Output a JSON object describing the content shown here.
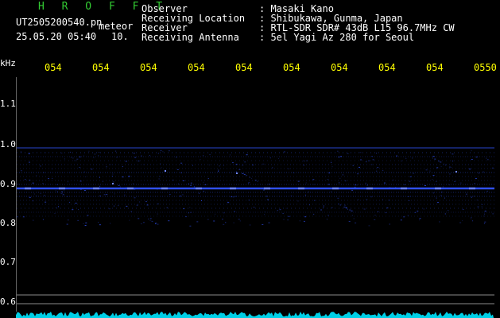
{
  "header": {
    "app_title": "H R O F F T",
    "file_name": "UT2505200540.pn",
    "tag": "meteor",
    "datetime": "25.05.20 05:40",
    "interval": "10."
  },
  "station": [
    {
      "label": "Observer",
      "value": ":  Masaki Kano"
    },
    {
      "label": "Receiving Location",
      "value": ":  Shibukawa, Gunma, Japan"
    },
    {
      "label": "Receiver",
      "value": ":  RTL-SDR SDR# 43dB L15 96.7MHz CW"
    },
    {
      "label": "Receiving Antenna",
      "value": ":  5el Yagi Az 280 for Seoul"
    }
  ],
  "axis": {
    "unit": "kHz",
    "time_ticks": [
      "054",
      "054",
      "054",
      "054",
      "054",
      "054",
      "054",
      "054",
      "054",
      "0550"
    ],
    "freq_ticks": [
      "1.1",
      "1.0",
      "0.9",
      "0.8",
      "0.7",
      "0.6"
    ]
  },
  "colors": {
    "background": "#000000",
    "title": "#33cc33",
    "ticks": "#ffff00",
    "signal": "#3355ff",
    "spectrum": "#00e5ff"
  }
}
